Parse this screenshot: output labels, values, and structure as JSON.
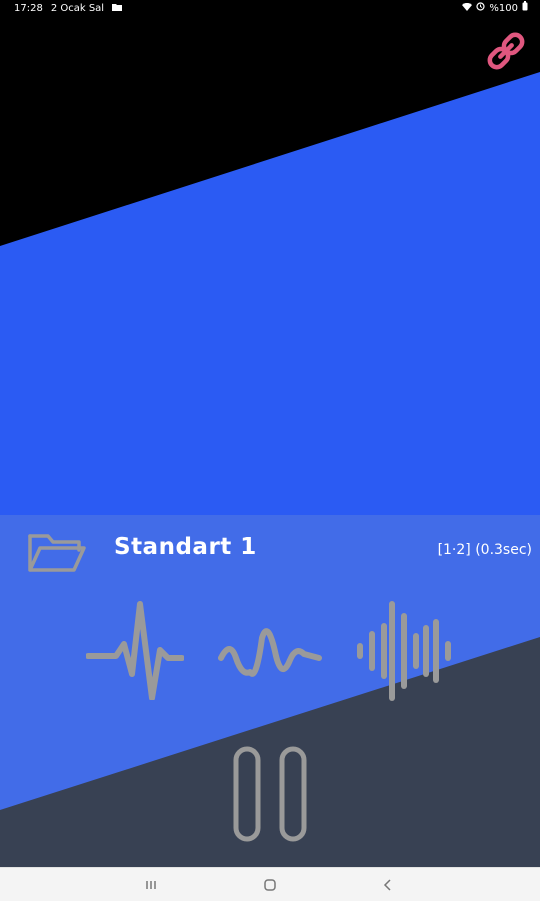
{
  "status_bar": {
    "time": "17:28",
    "date": "2 Ocak Sal",
    "battery": "%100"
  },
  "colors": {
    "blue": "#2B5BF3",
    "dark": "#1D1D1D",
    "accent_link": "#E0577F",
    "icon_gray": "#9A9A9A"
  },
  "preset": {
    "name": "Standart 1",
    "info": "[1·2] (0.3sec)"
  },
  "icons": {
    "link": "link-icon",
    "folder": "folder-icon",
    "wave1": "heartbeat-wave-icon",
    "wave2": "sine-wave-icon",
    "wave3": "audio-wave-icon",
    "pause": "pause-icon",
    "recents": "recents-icon",
    "home": "home-icon",
    "back": "back-icon"
  }
}
